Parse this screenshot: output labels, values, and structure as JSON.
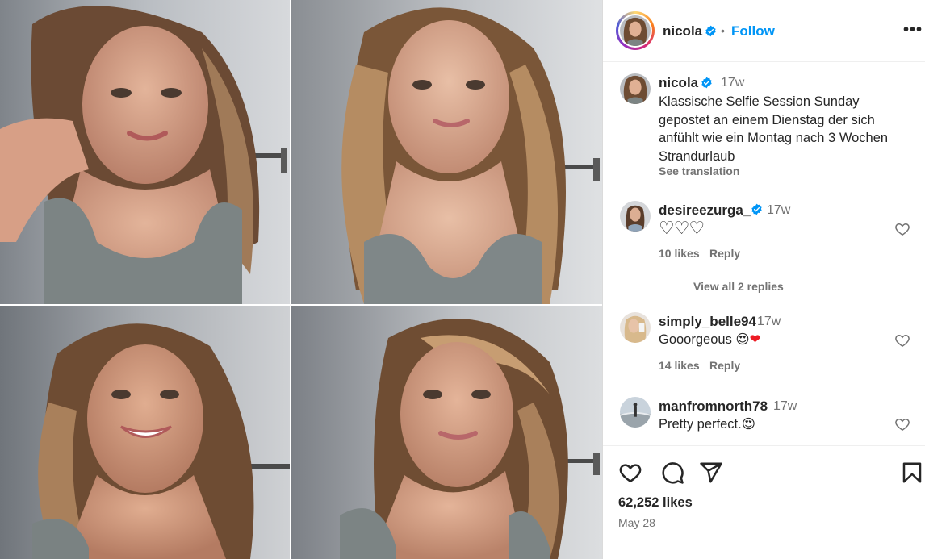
{
  "post": {
    "author": "nicola",
    "separator": "•",
    "follow_label": "Follow",
    "more_label": "•••",
    "caption_time": "17w",
    "caption_lines": [
      "Klassische Selfie Session Sunday",
      "gepostet an einem Dienstag der sich",
      "anfühlt wie ein Montag nach 3 Wochen",
      "Strandurlaub"
    ],
    "see_translation": "See translation"
  },
  "comments": [
    {
      "username": "desireezurga_",
      "verified": true,
      "time": "17w",
      "text": "♡♡♡",
      "likes": "10 likes",
      "reply": "Reply",
      "view_replies": "View all 2 replies"
    },
    {
      "username": "simply_belle94",
      "verified": false,
      "time": "17w",
      "text": "Gooorgeous",
      "emoji": [
        "😍",
        "❤"
      ],
      "likes": "14 likes",
      "reply": "Reply"
    },
    {
      "username": "manfromnorth78",
      "verified": false,
      "time": "17w",
      "text": "Pretty perfect.",
      "emoji": [
        "😍"
      ]
    }
  ],
  "footer": {
    "likes": "62,252 likes",
    "date": "May 28"
  },
  "colors": {
    "accent": "#0095f6",
    "verified": "#0095f6",
    "muted": "#737373",
    "heart_red": "#ed1c24"
  },
  "icons": [
    "heart-icon",
    "comment-icon",
    "share-icon",
    "save-icon",
    "verified-icon",
    "more-icon"
  ]
}
